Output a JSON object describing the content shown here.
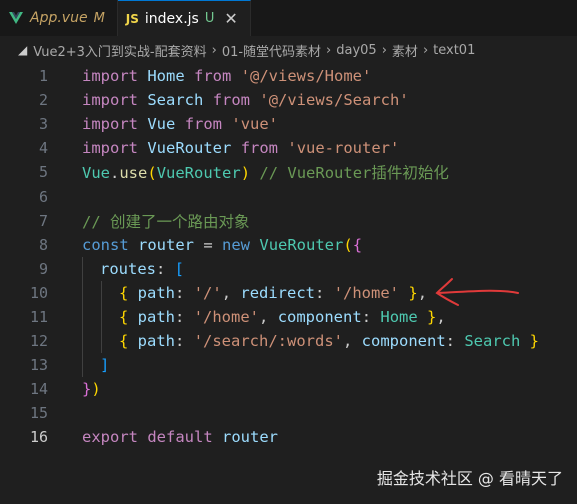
{
  "tabs": [
    {
      "label": "App.vue",
      "flag": "M",
      "icon": "vue-icon"
    },
    {
      "label": "index.js",
      "flag": "U",
      "icon": "js-icon",
      "icon_text": "JS",
      "close": "✕"
    }
  ],
  "breadcrumb": [
    "Vue2+3入门到实战-配套资料",
    "01-随堂代码素材",
    "day05",
    "素材",
    "text01"
  ],
  "code": {
    "line_numbers": [
      "1",
      "2",
      "3",
      "4",
      "5",
      "6",
      "7",
      "8",
      "9",
      "10",
      "11",
      "12",
      "13",
      "14",
      "15",
      "16"
    ],
    "l1": {
      "k": "import",
      "id": "Home",
      "f": "from",
      "s": "'@/views/Home'"
    },
    "l2": {
      "k": "import",
      "id": "Search",
      "f": "from",
      "s": "'@/views/Search'"
    },
    "l3": {
      "k": "import",
      "id": "Vue",
      "f": "from",
      "s": "'vue'"
    },
    "l4": {
      "k": "import",
      "id": "VueRouter",
      "f": "from",
      "s": "'vue-router'"
    },
    "l5": {
      "obj": "Vue",
      "dot": ".",
      "fn": "use",
      "p1": "(",
      "arg": "VueRouter",
      "p2": ")",
      "cm": "// VueRouter插件初始化"
    },
    "l7": {
      "cm": "// 创建了一个路由对象"
    },
    "l8": {
      "k": "const",
      "id": "router",
      "eq": " = ",
      "new": "new",
      "cls": "VueRouter",
      "p": "(",
      "b": "{"
    },
    "l9": {
      "key": "routes",
      "colon": ": ",
      "br": "["
    },
    "l10": {
      "o": "{",
      "k1": " path",
      "c1": ": ",
      "v1": "'/'",
      "cm1": ", ",
      "k2": "redirect",
      "c2": ": ",
      "v2": "'/home'",
      "cl": " }",
      "end": ","
    },
    "l11": {
      "o": "{",
      "k1": " path",
      "c1": ": ",
      "v1": "'/home'",
      "cm1": ", ",
      "k2": "component",
      "c2": ": ",
      "v2": "Home",
      "cl": " }",
      "end": ","
    },
    "l12": {
      "o": "{",
      "k1": " path",
      "c1": ": ",
      "v1": "'/search/:words'",
      "cm1": ", ",
      "k2": "component",
      "c2": ": ",
      "v2": "Search",
      "cl": " }"
    },
    "l13": {
      "br": "]"
    },
    "l14": {
      "b": "}",
      "p": ")"
    },
    "l16": {
      "k": "export",
      "d": "default",
      "id": "router"
    }
  },
  "watermark": "掘金技术社区 @ 看晴天了",
  "colors": {
    "keyword": "#c586c0",
    "string": "#ce9178",
    "variable": "#9cdcfe",
    "comment": "#6a9955",
    "annotation_arrow": "#e03a3a"
  }
}
